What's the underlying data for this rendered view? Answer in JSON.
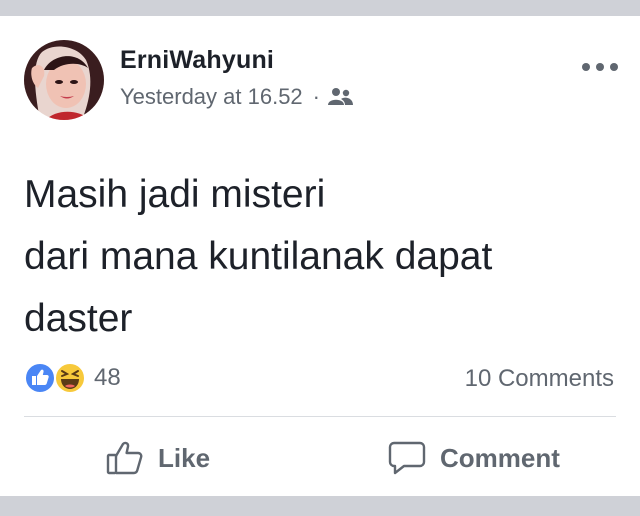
{
  "post": {
    "author": "ErniWahyuni",
    "timestamp": "Yesterday at 16.52",
    "separator": "·",
    "audience_icon": "friends-icon",
    "more_icon": "more-options-icon",
    "text_lines": [
      "Masih jadi misteri",
      "dari mana kuntilanak dapat",
      "daster"
    ]
  },
  "stats": {
    "reaction_icons": [
      "like-reaction-icon",
      "haha-reaction-icon"
    ],
    "reaction_count": "48",
    "comments": "10 Comments"
  },
  "actions": {
    "like_label": "Like",
    "comment_label": "Comment"
  },
  "colors": {
    "page_background": "#cfd1d7",
    "card": "#ffffff",
    "text_primary": "#1d2129",
    "text_secondary": "#606770",
    "like_blue": "#4a86f5",
    "haha_yellow": "#f7c93b",
    "divider": "#dadde1"
  }
}
